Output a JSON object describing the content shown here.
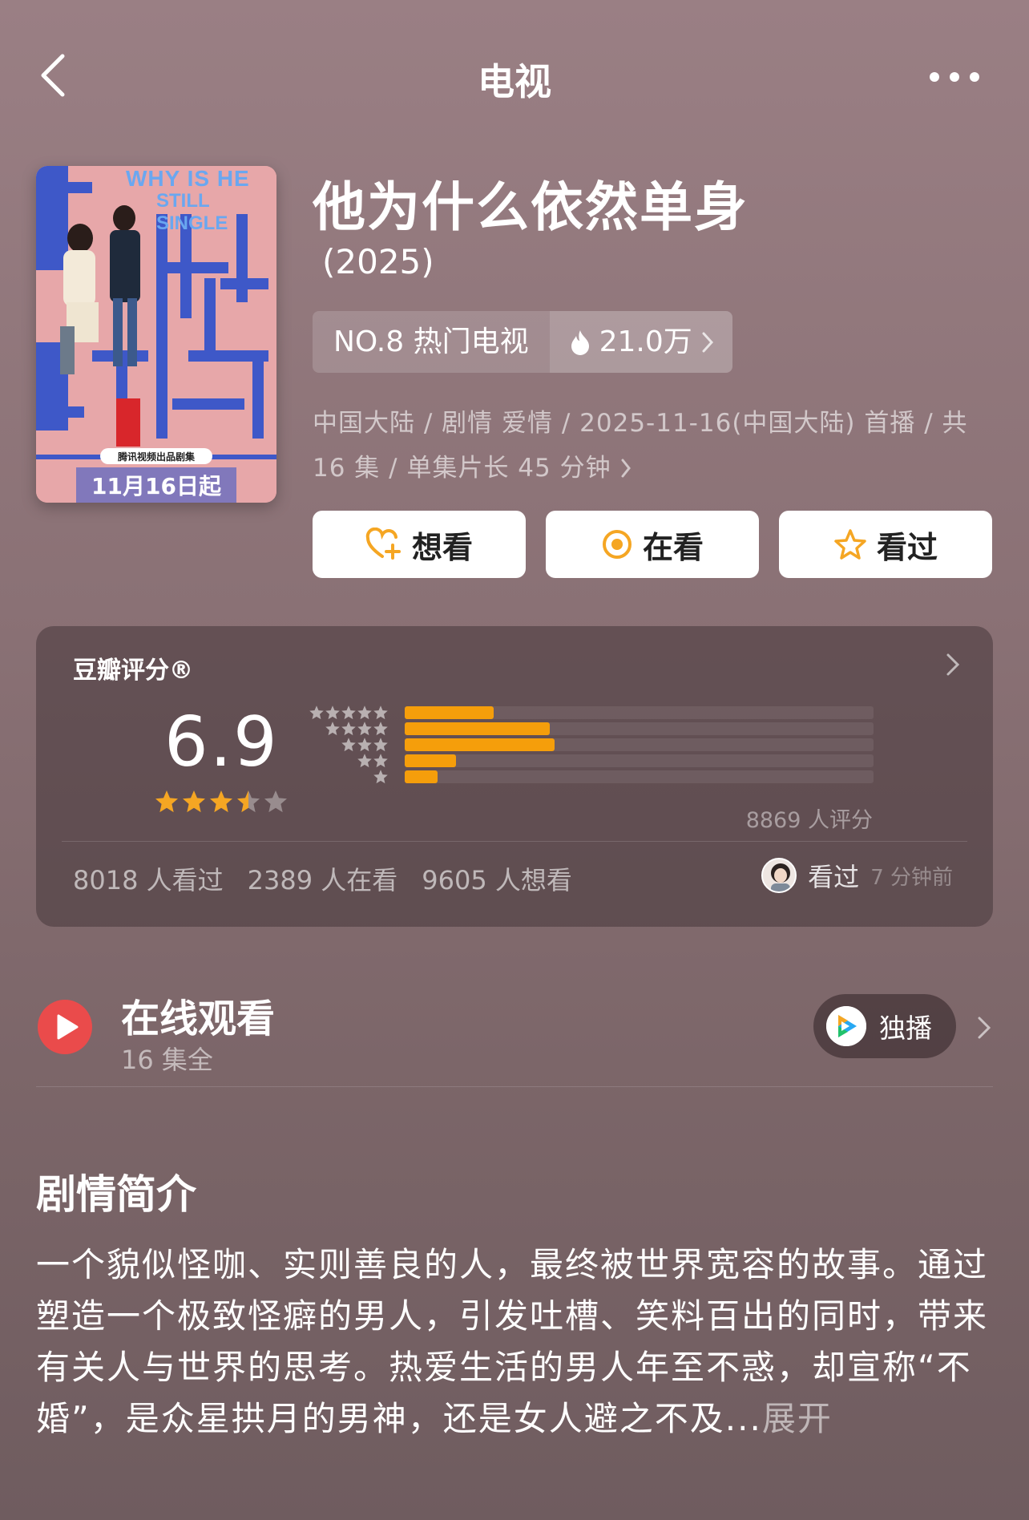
{
  "nav": {
    "title": "电视"
  },
  "poster": {
    "en_title_1": "WHY IS HE",
    "en_title_2": "STILL SINGLE",
    "cn_title": "他为什么依然单身",
    "producer": "腾讯视频出品剧集",
    "date": "11月16日起"
  },
  "show": {
    "title": "他为什么依然单身",
    "year": "(2025)",
    "rank_label": "NO.8 热门电视",
    "heat": "21.0万",
    "meta_line1": "中国大陆 / 剧情 爱情 / 2025-11-16(中国大陆) 首播 / 共",
    "meta_line2": "16 集 / 单集片长 45 分钟"
  },
  "actions": {
    "want": "想看",
    "watching": "在看",
    "watched": "看过"
  },
  "rating": {
    "title": "豆瓣评分®",
    "score": "6.9",
    "score_stars": 3.5,
    "distribution": [
      {
        "stars": 5,
        "fraction": 0.19
      },
      {
        "stars": 4,
        "fraction": 0.31
      },
      {
        "stars": 3,
        "fraction": 0.32
      },
      {
        "stars": 2,
        "fraction": 0.11
      },
      {
        "stars": 1,
        "fraction": 0.07
      }
    ],
    "total": "8869 人评分",
    "watched": "8018 人看过",
    "watching": "2389 人在看",
    "want": "9605 人想看",
    "friend_action": "看过",
    "friend_time": "7 分钟前"
  },
  "watch": {
    "title": "在线观看",
    "episodes": "16 集全",
    "platform_label": "独播"
  },
  "synopsis": {
    "title": "剧情简介",
    "text": "一个貌似怪咖、实则善良的人，最终被世界宽容的故事。通过塑造一个极致怪癖的男人，引发吐槽、笑料百出的同时，带来有关人与世界的思考。热爱生活的男人年至不惑，却宣称“不婚”，是众星拱月的男神，还是女人避之不及...",
    "expand": "展开"
  },
  "colors": {
    "accent": "#f59e0b",
    "play": "#ea4b4b"
  }
}
